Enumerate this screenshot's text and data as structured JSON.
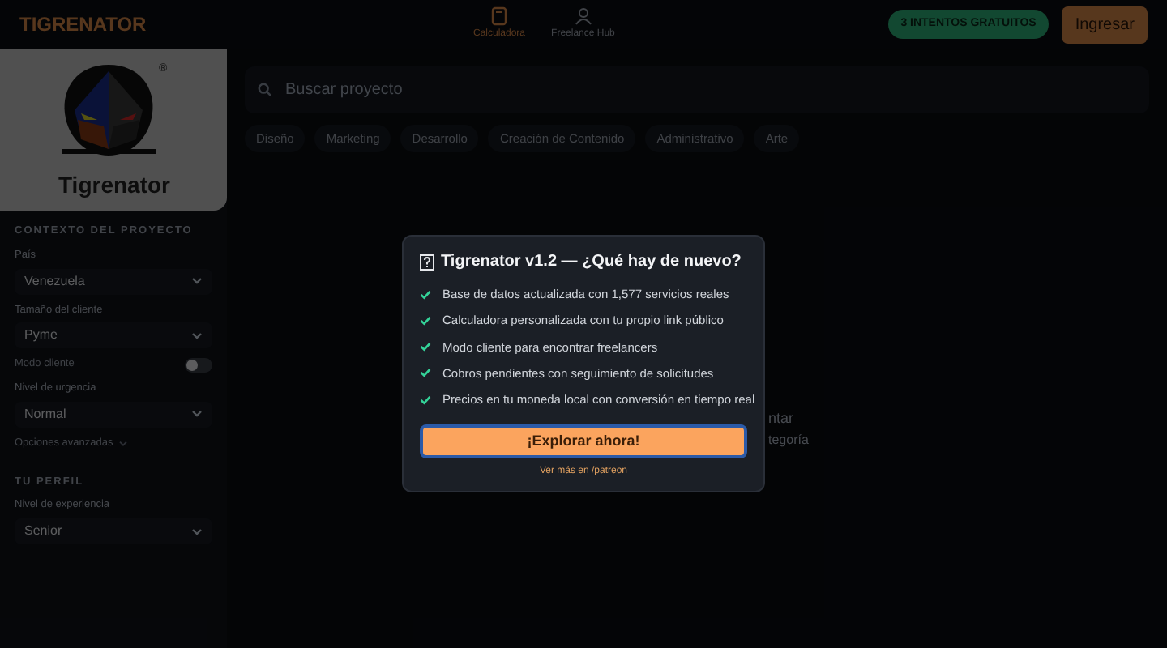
{
  "header": {
    "brand": "TIGRENATOR",
    "nav": [
      {
        "label": "Calculadora",
        "selected": true
      },
      {
        "label": "Freelance Hub",
        "selected": false
      }
    ],
    "badge": "3 INTENTOS GRATUITOS",
    "login_button": "Ingresar"
  },
  "sidebar": {
    "logo_text": "Tigrenator",
    "logo_mark": "®",
    "sections": [
      {
        "title": "CONTEXTO DEL PROYECTO",
        "fields": [
          {
            "kind": "select",
            "label": "País",
            "value": "Venezuela"
          },
          {
            "kind": "select",
            "label": "Tamaño del cliente",
            "value": "Pyme"
          },
          {
            "kind": "toggle",
            "label": "Modo cliente",
            "on": false
          },
          {
            "kind": "select",
            "label": "Nivel de urgencia",
            "value": "Normal"
          },
          {
            "kind": "expander",
            "label": "Opciones avanzadas"
          }
        ]
      },
      {
        "title": "TU PERFIL",
        "fields": [
          {
            "kind": "select",
            "label": "Nivel de experiencia",
            "value": "Senior"
          }
        ]
      }
    ]
  },
  "search": {
    "placeholder": "Buscar proyecto"
  },
  "categories": [
    "Diseño",
    "Marketing",
    "Desarrollo",
    "Creación de Contenido",
    "Administrativo",
    "Arte"
  ],
  "background_text": [
    "ntar",
    "tegoría"
  ],
  "modal": {
    "title": "Tigrenator v1.2 — ¿Qué hay de nuevo?",
    "items": [
      "Base de datos actualizada con 1,577 servicios reales",
      "Calculadora personalizada con tu propio link público",
      "Modo cliente para encontrar freelancers",
      "Cobros pendientes con seguimiento de solicitudes",
      "Precios en tu moneda local con conversión en tiempo real"
    ],
    "primary_button": "¡Explorar ahora!",
    "link": "Ver más en /patreon"
  }
}
